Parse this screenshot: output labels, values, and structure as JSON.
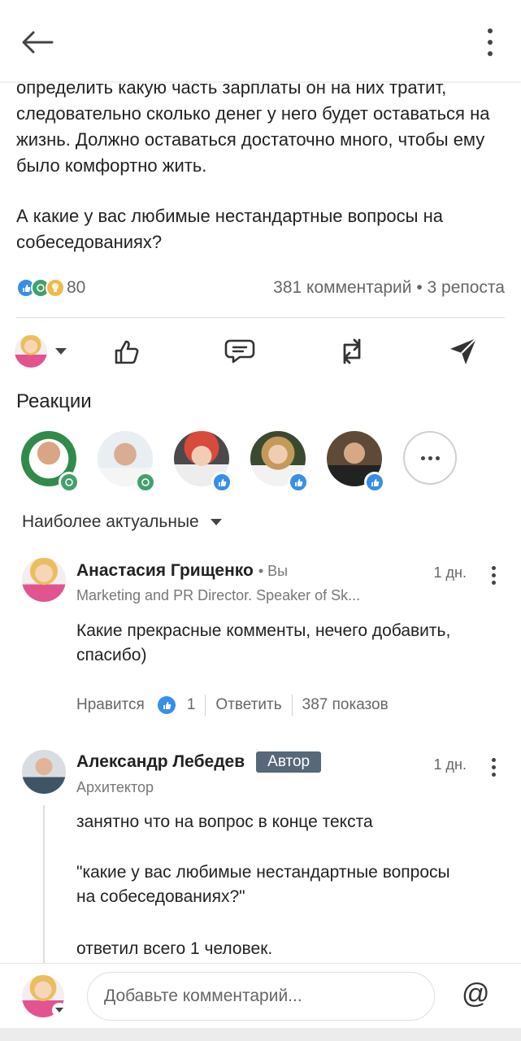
{
  "post": {
    "lines_1": "определить какую часть зарплаты он на них тратит, следовательно сколько денег у него будет оставаться на жизнь. Должно оставаться достаточно много, чтобы ему было комфортно жить.",
    "lines_2": "А какие у вас любимые нестандартные вопросы на собеседованиях?"
  },
  "stats": {
    "reactions_count": "80",
    "comments_reposts": "381 комментарий • 3 репоста"
  },
  "reactions_section": {
    "title": "Реакции"
  },
  "sort": {
    "label": "Наиболее актуальные"
  },
  "comments": [
    {
      "name": "Анастасия Грищенко",
      "you": "• Вы",
      "subtitle": "Marketing and PR Director. Speaker of Sk...",
      "time": "1 дн.",
      "text": "Какие прекрасные комменты, нечего добавить, спасибо)",
      "like_label": "Нравится",
      "like_count": "1",
      "reply_label": "Ответить",
      "views": "387 показов"
    },
    {
      "name": "Александр Лебедев",
      "badge": "Автор",
      "subtitle": "Архитектор",
      "time": "1 дн.",
      "text_1": "занятно что на вопрос в конце текста",
      "text_2": "\"какие у вас любимые нестандартные вопросы на собеседованиях?\"",
      "text_3": "ответил всего 1 человек."
    }
  ],
  "composer": {
    "placeholder": "Добавьте комментарий...",
    "at_symbol": "@"
  },
  "colors": {
    "like_blue": "#378fe9",
    "celebrate_green": "#44a06b",
    "author_badge": "#56687a"
  }
}
